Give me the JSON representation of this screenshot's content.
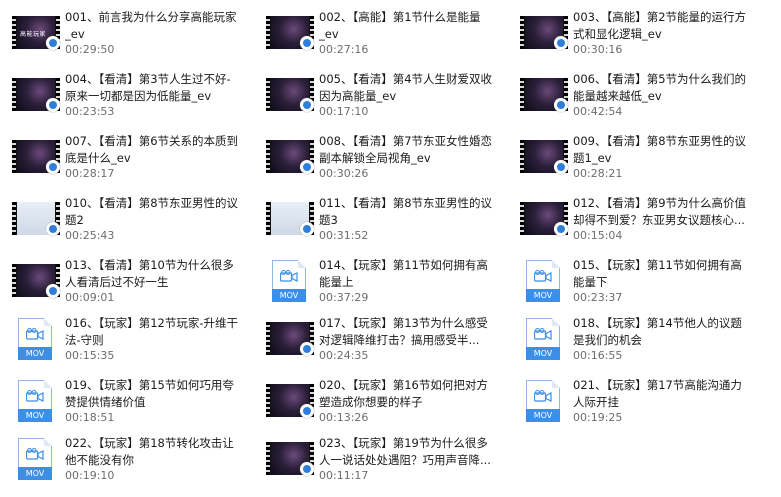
{
  "files": [
    {
      "line1": "001、前言我为什么分享高能玩家",
      "line2": "_ev",
      "duration": "00:29:50",
      "type": "video",
      "caption": "高能玩家"
    },
    {
      "line1": "002、【高能】第1节什么是能量",
      "line2": "_ev",
      "duration": "00:27:16",
      "type": "video"
    },
    {
      "line1": "003、【高能】第2节能量的运行方",
      "line2": "式和显化逻辑_ev",
      "duration": "00:30:16",
      "type": "video"
    },
    {
      "line1": "004、【看清】第3节人生过不好-",
      "line2": "原来一切都是因为低能量_ev",
      "duration": "00:23:53",
      "type": "video"
    },
    {
      "line1": "005、【看清】第4节人生财爱双收",
      "line2": "因为高能量_ev",
      "duration": "00:17:10",
      "type": "video"
    },
    {
      "line1": "006、【看清】第5节为什么我们的",
      "line2": "能量越来越低_ev",
      "duration": "00:42:54",
      "type": "video"
    },
    {
      "line1": "007、【看清】第6节关系的本质到",
      "line2": "底是什么_ev",
      "duration": "00:28:17",
      "type": "video"
    },
    {
      "line1": "008、【看清】第7节东亚女性婚恋",
      "line2": "副本解锁全局视角_ev",
      "duration": "00:30:26",
      "type": "video"
    },
    {
      "line1": "009、【看清】第8节东亚男性的议",
      "line2": "题1_ev",
      "duration": "00:28:21",
      "type": "video"
    },
    {
      "line1": "010、【看清】第8节东亚男性的议",
      "line2": "题2",
      "duration": "00:25:43",
      "type": "video",
      "light": true
    },
    {
      "line1": "011、【看清】第8节东亚男性的议",
      "line2": "题3",
      "duration": "00:31:52",
      "type": "video",
      "light": true
    },
    {
      "line1": "012、【看清】第9节为什么高价值",
      "line2": "却得不到爱？东亚男女议题核心...",
      "duration": "00:15:04",
      "type": "video"
    },
    {
      "line1": "013、【看清】第10节为什么很多",
      "line2": "人看清后过不好一生",
      "duration": "00:09:01",
      "type": "video"
    },
    {
      "line1": "014、【玩家】第11节如何拥有高",
      "line2": "能量上",
      "duration": "00:37:29",
      "type": "mov"
    },
    {
      "line1": "015、【玩家】第11节如何拥有高",
      "line2": "能量下",
      "duration": "00:23:37",
      "type": "mov"
    },
    {
      "line1": "016、【玩家】第12节玩家-升维干",
      "line2": "法-守则",
      "duration": "00:15:35",
      "type": "mov"
    },
    {
      "line1": "017、【玩家】第13节为什么感受",
      "line2": "对逻辑降维打击？搞用感受半...",
      "duration": "00:24:35",
      "type": "video"
    },
    {
      "line1": "018、【玩家】第14节他人的议题",
      "line2": "是我们的机会",
      "duration": "00:16:55",
      "type": "mov"
    },
    {
      "line1": "019、【玩家】第15节如何巧用夸",
      "line2": "赞提供情绪价值",
      "duration": "00:18:51",
      "type": "mov"
    },
    {
      "line1": "020、【玩家】第16节如何把对方",
      "line2": "塑造成你想要的样子",
      "duration": "00:13:26",
      "type": "video"
    },
    {
      "line1": "021、【玩家】第17节高能沟通力",
      "line2": "人际开挂",
      "duration": "00:19:25",
      "type": "mov"
    },
    {
      "line1": "022、【玩家】第18节转化攻击让",
      "line2": "他不能没有你",
      "duration": "00:19:10",
      "type": "mov"
    },
    {
      "line1": "023、【玩家】第19节为什么很多",
      "line2": "人一说话处处遇阻？巧用声音降...",
      "duration": "00:11:17",
      "type": "video"
    }
  ],
  "mov_label": "MOV",
  "colors": {
    "mov_tag": "#3d8ee6",
    "duration": "#6d6d6d"
  }
}
